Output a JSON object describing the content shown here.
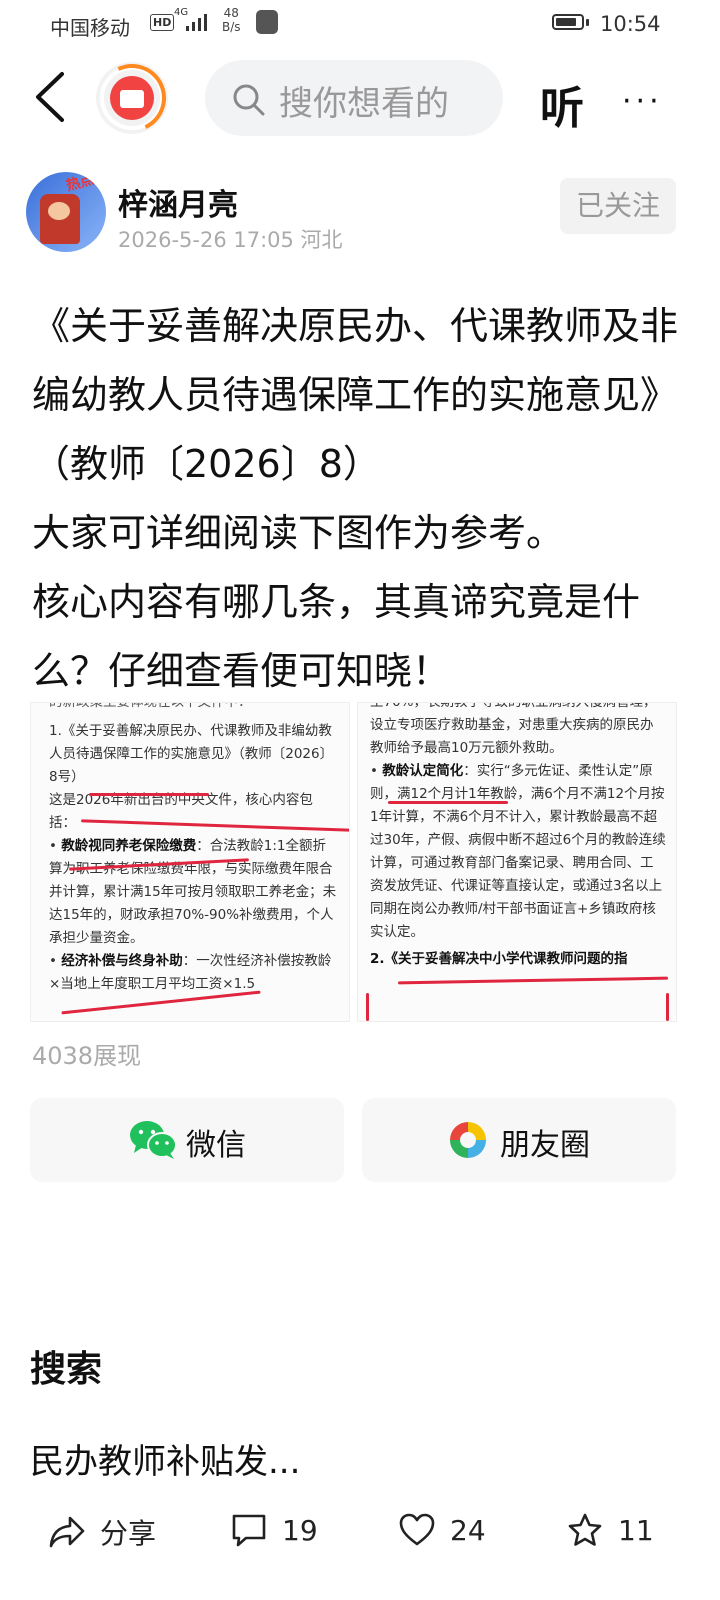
{
  "status_bar": {
    "carrier": "中国移动",
    "hd": "HD",
    "network": "4G",
    "speed_value": "48",
    "speed_unit": "B/s",
    "time": "10:54"
  },
  "nav": {
    "search_placeholder": "搜你想看的",
    "listen_label": "听",
    "more_label": "···"
  },
  "author": {
    "avatar_tag": "热点",
    "name": "梓涵月亮",
    "meta": "2026-5-26 17:05 河北",
    "follow_label": "已关注"
  },
  "post": {
    "paragraph1": "《关于妥善解决原民办、代课教师及非编幼教人员待遇保障工作的实施意见》（教师〔2026〕8）",
    "paragraph2": "大家可详细阅读下图作为参考。",
    "paragraph3": "核心内容有哪几条，其真谛究竟是什么？仔细查看便可知晓！",
    "views": "4038展现"
  },
  "image1": {
    "line0": "的新政策主要体现在以下文件中：",
    "item_title": "1.《关于妥善解决原民办、代课教师及非编幼教人员待遇保障工作的实施意见》（教师〔2026〕8号）",
    "intro": "这是2026年新出台的中央文件，核心内容包括：",
    "bullet1_head": "教龄视同养老保险缴费",
    "bullet1_body": "：合法教龄1:1全额折算为职工养老保险缴费年限，与实际缴费年限合并计算，累计满15年可按月领取职工养老金；未达15年的，财政承担70%-90%补缴费用，个人承担少量资金。",
    "bullet2_head": "经济补偿与终身补助",
    "bullet2_body": "：一次性经济补偿按教龄×当地上年度职工月平均工资×1.5"
  },
  "image2": {
    "line0": "至70%，长期教学导致的职业病纳入慢病管理，设立专项医疗救助基金，对患重大疾病的原民办教师给予最高10万元额外救助。",
    "bullet_head": "教龄认定简化",
    "bullet_body": "：实行“多元佐证、柔性认定”原则，满12个月计1年教龄，满6个月不满12个月按1年计算，不满6个月不计入，累计教龄最高不超过30年，产假、病假中断不超过6个月的教龄连续计算，可通过教育部门备案记录、聘用合同、工资发放凭证、代课证等直接认定，或通过3名以上同期在岗公办教师/村干部书面证言+乡镇政府核实认定。",
    "item2_title": "2.《关于妥善解决中小学代课教师问题的指"
  },
  "share": {
    "wechat_label": "微信",
    "moments_label": "朋友圈"
  },
  "search_section": {
    "title": "搜索",
    "item": "民办教师补贴发..."
  },
  "bottom_bar": {
    "share_label": "分享",
    "comments": "19",
    "likes": "24",
    "favorites": "11"
  },
  "colors": {
    "wechat_green": "#20c05c",
    "underline_red": "#e0263f",
    "logo_red": "#f24343",
    "logo_orange": "#ff8a1f"
  }
}
